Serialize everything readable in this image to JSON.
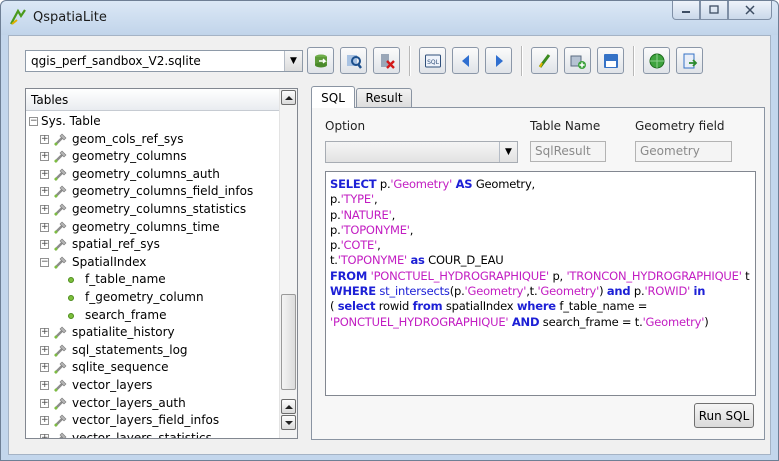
{
  "window": {
    "title": "QspatiaLite"
  },
  "database": {
    "selected": "qgis_perf_sandbox_V2.sqlite"
  },
  "toolbar": {
    "buttons": [
      {
        "name": "connect-db-button",
        "icon": "db-connect-icon"
      },
      {
        "name": "search-db-button",
        "icon": "magnifier-icon"
      },
      {
        "name": "delete-button",
        "icon": "delete-icon"
      },
      {
        "name": "sql-button",
        "icon": "sql-icon"
      },
      {
        "name": "previous-button",
        "icon": "arrow-left-icon"
      },
      {
        "name": "next-button",
        "icon": "arrow-right-icon"
      },
      {
        "name": "edit-button",
        "icon": "pencil-icon"
      },
      {
        "name": "add-layer-button",
        "icon": "add-layer-icon"
      },
      {
        "name": "save-button",
        "icon": "save-icon"
      },
      {
        "name": "globe-button",
        "icon": "globe-icon"
      },
      {
        "name": "export-button",
        "icon": "export-icon"
      }
    ]
  },
  "tree": {
    "header": "Tables",
    "items": [
      {
        "label": "Sys. Table",
        "level": 0,
        "expander": "minus",
        "icon": "none"
      },
      {
        "label": "geom_cols_ref_sys",
        "level": 1,
        "expander": "plus",
        "icon": "table-icon"
      },
      {
        "label": "geometry_columns",
        "level": 1,
        "expander": "plus",
        "icon": "table-icon"
      },
      {
        "label": "geometry_columns_auth",
        "level": 1,
        "expander": "plus",
        "icon": "table-icon"
      },
      {
        "label": "geometry_columns_field_infos",
        "level": 1,
        "expander": "plus",
        "icon": "table-icon"
      },
      {
        "label": "geometry_columns_statistics",
        "level": 1,
        "expander": "plus",
        "icon": "table-icon"
      },
      {
        "label": "geometry_columns_time",
        "level": 1,
        "expander": "plus",
        "icon": "table-icon"
      },
      {
        "label": "spatial_ref_sys",
        "level": 1,
        "expander": "plus",
        "icon": "table-icon"
      },
      {
        "label": "SpatialIndex",
        "level": 1,
        "expander": "minus",
        "icon": "table-icon"
      },
      {
        "label": "f_table_name",
        "level": 2,
        "expander": "none",
        "icon": "column-icon"
      },
      {
        "label": "f_geometry_column",
        "level": 2,
        "expander": "none",
        "icon": "column-icon"
      },
      {
        "label": "search_frame",
        "level": 2,
        "expander": "none",
        "icon": "column-icon"
      },
      {
        "label": "spatialite_history",
        "level": 1,
        "expander": "plus",
        "icon": "table-icon"
      },
      {
        "label": "sql_statements_log",
        "level": 1,
        "expander": "plus",
        "icon": "table-icon"
      },
      {
        "label": "sqlite_sequence",
        "level": 1,
        "expander": "plus",
        "icon": "table-icon"
      },
      {
        "label": "vector_layers",
        "level": 1,
        "expander": "plus",
        "icon": "table-icon"
      },
      {
        "label": "vector_layers_auth",
        "level": 1,
        "expander": "plus",
        "icon": "table-icon"
      },
      {
        "label": "vector_layers_field_infos",
        "level": 1,
        "expander": "plus",
        "icon": "table-icon"
      },
      {
        "label": "vector_layers_statistics",
        "level": 1,
        "expander": "plus",
        "icon": "table-icon"
      }
    ]
  },
  "tabs": [
    {
      "label": "SQL",
      "active": true
    },
    {
      "label": "Result",
      "active": false
    }
  ],
  "sql_panel": {
    "option_label": "Option",
    "option_value": "",
    "table_name_label": "Table Name",
    "table_name_value": "SqlResult",
    "geometry_field_label": "Geometry field",
    "geometry_field_value": "Geometry",
    "run_button": "Run SQL",
    "query_lines": [
      [
        {
          "t": "SELECT",
          "c": "kw"
        },
        {
          "t": " p.",
          "c": ""
        },
        {
          "t": "'Geometry'",
          "c": "str"
        },
        {
          "t": " ",
          "c": ""
        },
        {
          "t": "AS",
          "c": "kw"
        },
        {
          "t": " Geometry,",
          "c": ""
        }
      ],
      [
        {
          "t": "p.",
          "c": ""
        },
        {
          "t": "'TYPE'",
          "c": "str"
        },
        {
          "t": ",",
          "c": ""
        }
      ],
      [
        {
          "t": "p.",
          "c": ""
        },
        {
          "t": "'NATURE'",
          "c": "str"
        },
        {
          "t": ",",
          "c": ""
        }
      ],
      [
        {
          "t": "p.",
          "c": ""
        },
        {
          "t": "'TOPONYME'",
          "c": "str"
        },
        {
          "t": ",",
          "c": ""
        }
      ],
      [
        {
          "t": "p.",
          "c": ""
        },
        {
          "t": "'COTE'",
          "c": "str"
        },
        {
          "t": ",",
          "c": ""
        }
      ],
      [
        {
          "t": "t.",
          "c": ""
        },
        {
          "t": "'TOPONYME'",
          "c": "str"
        },
        {
          "t": " ",
          "c": ""
        },
        {
          "t": "as",
          "c": "kw"
        },
        {
          "t": " COUR_D_EAU",
          "c": ""
        }
      ],
      [
        {
          "t": "FROM",
          "c": "kw"
        },
        {
          "t": " ",
          "c": ""
        },
        {
          "t": "'PONCTUEL_HYDROGRAPHIQUE'",
          "c": "str"
        },
        {
          "t": " p, ",
          "c": ""
        },
        {
          "t": "'TRONCON_HYDROGRAPHIQUE'",
          "c": "str"
        },
        {
          "t": " t",
          "c": ""
        }
      ],
      [
        {
          "t": "WHERE",
          "c": "kw"
        },
        {
          "t": " ",
          "c": ""
        },
        {
          "t": "st_intersects",
          "c": "fn"
        },
        {
          "t": "(p.",
          "c": ""
        },
        {
          "t": "'Geometry'",
          "c": "str"
        },
        {
          "t": ",t.",
          "c": ""
        },
        {
          "t": "'Geometry'",
          "c": "str"
        },
        {
          "t": ") ",
          "c": ""
        },
        {
          "t": "and",
          "c": "kw"
        },
        {
          "t": " p.",
          "c": ""
        },
        {
          "t": "'ROWID'",
          "c": "str"
        },
        {
          "t": " ",
          "c": ""
        },
        {
          "t": "in",
          "c": "kw"
        }
      ],
      [
        {
          "t": "( ",
          "c": ""
        },
        {
          "t": "select",
          "c": "kw"
        },
        {
          "t": " rowid ",
          "c": ""
        },
        {
          "t": "from",
          "c": "kw"
        },
        {
          "t": " spatialIndex ",
          "c": ""
        },
        {
          "t": "where",
          "c": "kw"
        },
        {
          "t": " f_table_name =",
          "c": ""
        }
      ],
      [
        {
          "t": "'PONCTUEL_HYDROGRAPHIQUE'",
          "c": "str"
        },
        {
          "t": " ",
          "c": ""
        },
        {
          "t": "AND",
          "c": "kw"
        },
        {
          "t": " search_frame = t.",
          "c": ""
        },
        {
          "t": "'Geometry'",
          "c": "str"
        },
        {
          "t": ")",
          "c": ""
        }
      ]
    ]
  },
  "colors": {
    "keyword": "#1d20d6",
    "string": "#c21dc2",
    "frame": "#c3d6ec"
  }
}
